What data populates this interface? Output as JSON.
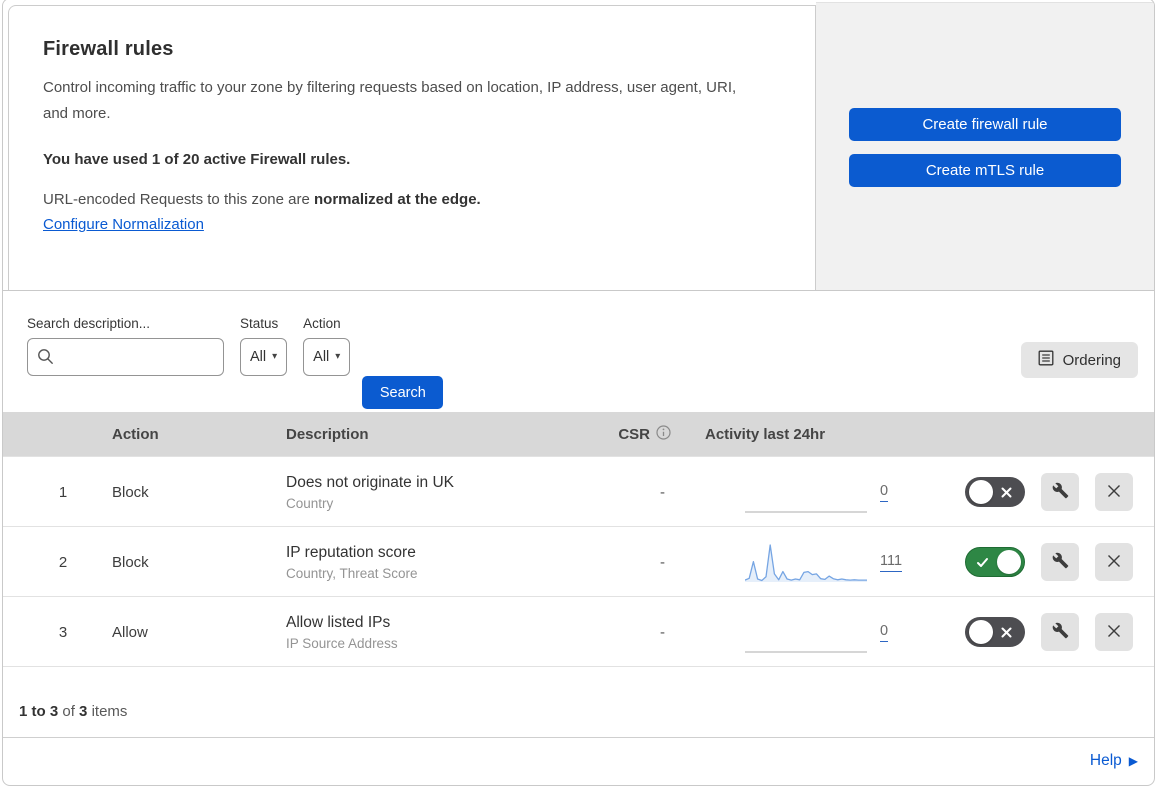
{
  "header": {
    "title": "Firewall rules",
    "description": "Control incoming traffic to your zone by filtering requests based on location, IP address, user agent, URI, and more.",
    "usage": "You have used 1 of 20 active Firewall rules.",
    "normalization_text": "URL-encoded Requests to this zone are",
    "normalization_bold": "normalized at the edge.",
    "normalization_link": "Configure Normalization"
  },
  "side_panel": {
    "buttons": [
      {
        "label": "Create firewall rule"
      },
      {
        "label": "Create mTLS rule"
      }
    ]
  },
  "filters": {
    "search_label": "Search description...",
    "search_value": "",
    "search_icon": "magnifier",
    "status_label": "Status",
    "status_value": "All",
    "action_label": "Action",
    "action_value": "All",
    "search_button": "Search",
    "ordering_button": "Ordering",
    "dropdown_caret": "▾"
  },
  "table": {
    "columns": {
      "action": "Action",
      "description": "Description",
      "csr": "CSR",
      "csr_icon": "info-circle",
      "activity": "Activity last 24hr"
    },
    "rows": [
      {
        "index": "1",
        "action": "Block",
        "description": "Does not originate in UK",
        "fields": "Country",
        "csr": "-",
        "activity_count": "0",
        "enabled": false,
        "sparkline": "flat"
      },
      {
        "index": "2",
        "action": "Block",
        "description": "IP reputation score",
        "fields": "Country, Threat Score",
        "csr": "-",
        "activity_count": "111",
        "enabled": true,
        "sparkline": "data"
      },
      {
        "index": "3",
        "action": "Allow",
        "description": "Allow listed IPs",
        "fields": "IP Source Address",
        "csr": "-",
        "activity_count": "0",
        "enabled": false,
        "sparkline": "flat"
      }
    ],
    "sparkline_values": [
      5,
      10,
      55,
      8,
      4,
      14,
      100,
      22,
      6,
      28,
      8,
      5,
      8,
      6,
      26,
      28,
      20,
      22,
      9,
      7,
      16,
      9,
      6,
      8,
      6,
      5,
      6,
      5,
      5,
      5
    ]
  },
  "footer": {
    "range": "1 to 3",
    "of": "of",
    "total": "3",
    "items": "items"
  },
  "help": {
    "label": "Help",
    "arrow": "▶"
  },
  "colors": {
    "primary_blue": "#0b5bd0",
    "link_blue": "#0a5ad2",
    "toggle_on_green": "#2e8745",
    "toggle_off_gray": "#4d4d51",
    "sparkline_blue": "#76a5e3",
    "table_header_gray": "#d8d8d8",
    "side_panel_gray": "#f1f1f1"
  }
}
